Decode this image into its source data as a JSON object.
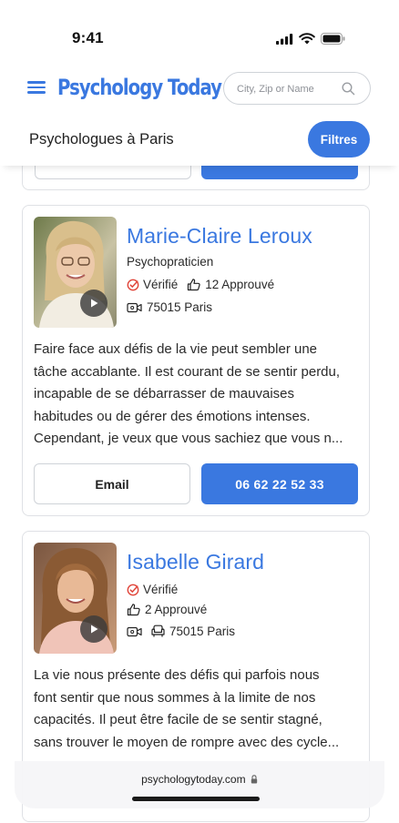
{
  "status": {
    "time": "9:41"
  },
  "header": {
    "logo": "Psychology Today",
    "search_placeholder": "City, Zip or Name"
  },
  "subheader": {
    "title": "Psychologues à Paris",
    "filter_label": "Filtres"
  },
  "profiles": [
    {
      "name": "Marie-Claire Leroux",
      "title": "Psychopraticien",
      "verified": "Vérifié",
      "endorsements": "12 Approuvé",
      "location": "75015 Paris",
      "bio_lines": [
        "Faire face aux défis de la vie peut sembler une",
        "tâche accablante. Il est courant de se sentir perdu,",
        "incapable de se débarrasser de mauvaises",
        "habitudes ou de gérer des émotions intenses.",
        "Cependant, je veux que vous sachiez que vous n..."
      ],
      "email_label": "Email",
      "phone": "06 62 22 52 33"
    },
    {
      "name": "Isabelle Girard",
      "verified": "Vérifié",
      "endorsements": "2 Approuvé",
      "location": "75015 Paris",
      "bio_lines": [
        "La vie nous présente des défis qui parfois nous",
        "font sentir que nous sommes à la limite de nos",
        "capacités. Il peut être facile de se sentir stagné,",
        "sans trouver le moyen de rompre avec des cycle..."
      ]
    }
  ],
  "browser": {
    "url": "psychologytoday.com"
  },
  "colors": {
    "accent": "#3a78e0",
    "border": "#dfe1e5",
    "verified": "#e0453a"
  }
}
